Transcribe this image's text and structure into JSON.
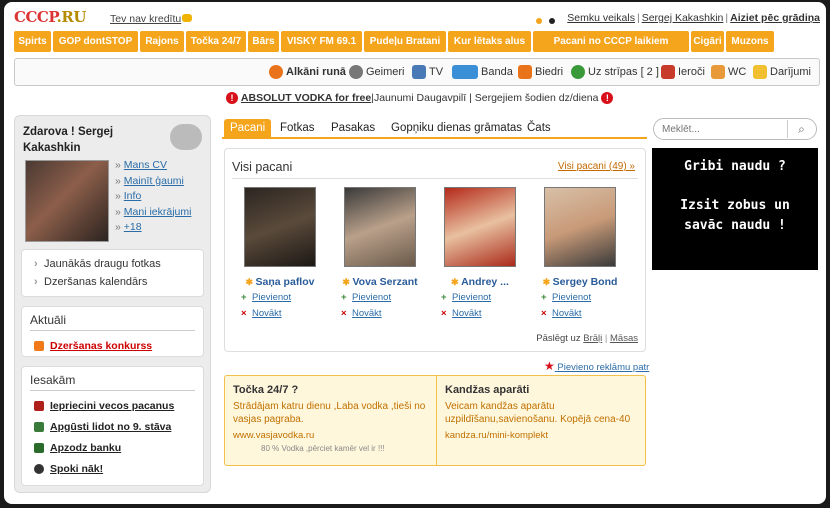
{
  "header": {
    "logo": "CCCP",
    "logo_suffix": ".RU",
    "credit_text": "Tev nav kredītu",
    "links": [
      "Semku veikals",
      "Sergej Kakashkin"
    ],
    "exit_link": "Aiziet pēc grādiņa"
  },
  "orange_nav": [
    "Spirts",
    "GOP dontSTOP",
    "Rajons",
    "Točka 24/7",
    "Bārs",
    "VISKY FM 69.1",
    "Pudeļu Bratani",
    "Kur lētaks alus",
    "Pacani no CCCP laikiem",
    "Cigāri",
    "Muzons"
  ],
  "menu": [
    {
      "label": "Alkāni runā",
      "icon": "chat-icon",
      "bold": true
    },
    {
      "label": "Geimeri",
      "icon": "gamepad-icon"
    },
    {
      "label": "TV",
      "icon": "tv-icon"
    },
    {
      "label": "Banda",
      "icon": "zapy-icon"
    },
    {
      "label": "Biedri",
      "icon": "friends-icon"
    },
    {
      "label": "Uz strīpas [ 2 ]",
      "icon": "globe-icon"
    },
    {
      "label": "Ieroči",
      "icon": "weapon-icon"
    },
    {
      "label": "WC",
      "icon": "wc-icon"
    },
    {
      "label": "Darījumi",
      "icon": "envelope-icon"
    }
  ],
  "announcement": {
    "bold": "ABSOLUT VODKA for free",
    "rest": "|Jaunumi Daugavpilī | Sergejiem šodien dz/diena"
  },
  "profile": {
    "greeting_line1": "Zdarova ! Sergej",
    "greeting_line2": "Kakashkin",
    "links": [
      "Mans CV",
      "Mainīt ģaumi",
      "Info",
      "Mani iekrājumi",
      "+18"
    ]
  },
  "sidebar_box1": [
    "Jaunākās draugu fotkas",
    "Dzeršanas kalendārs"
  ],
  "actual": {
    "title": "Aktuāli",
    "links": [
      "Dzeršanas konkurss"
    ]
  },
  "newbies": {
    "title": "Iesakām",
    "links": [
      {
        "text": "Iepriecini vecos pacanus",
        "icon": "cup-icon"
      },
      {
        "text": "Apgūsti lidot no 9. stāva",
        "icon": "person-icon"
      },
      {
        "text": "Apzodz banku",
        "icon": "money-bag-icon"
      },
      {
        "text": "Spoki nāk!",
        "icon": "ghost-icon"
      }
    ]
  },
  "tabs": [
    "Pacani",
    "Fotkas",
    "Pasakas",
    "Gopņiku dienas grāmatas",
    "Čats"
  ],
  "panel": {
    "title": "Visi pacani",
    "all_link": "Visi pacani (49) »",
    "people": [
      {
        "name": "Saņa paflov"
      },
      {
        "name": "Vova Serzant"
      },
      {
        "name": "Andrey ..."
      },
      {
        "name": "Sergey Bond"
      }
    ],
    "add_label": "Pievienot",
    "remove_label": "Novākt",
    "switch_prefix": "Pāslēgt uz",
    "switch_opts": [
      "Brāļi",
      "Māsas"
    ]
  },
  "add_ad_link": "Pievieno reklāmu patr",
  "ads": [
    {
      "title": "Točka 24/7 ?",
      "text": "Strādājam katru dienu ,Laba vodka ,tieši no vasjas pagraba.",
      "url": "www.vasjavodka.ru",
      "note": "80 % Vodka ,pērciet kamēr vel ir !!!"
    },
    {
      "title": "Kandžas aparāti",
      "text": "Veicam kandžas aparātu uzpildīšanu,savienošanu. Kopējā cena-40",
      "url": "kandza.ru/mini-komplekt"
    }
  ],
  "search": {
    "placeholder": "Meklēt..."
  },
  "black_ad": {
    "line1": "Gribi naudu ?",
    "line2": "Izsit zobus un",
    "line3": "savāc naudu !"
  },
  "colors": {
    "orange": "#f4a51c",
    "red": "#d8101a",
    "link_blue": "#2a6ca8",
    "ad_orange": "#c07000"
  }
}
